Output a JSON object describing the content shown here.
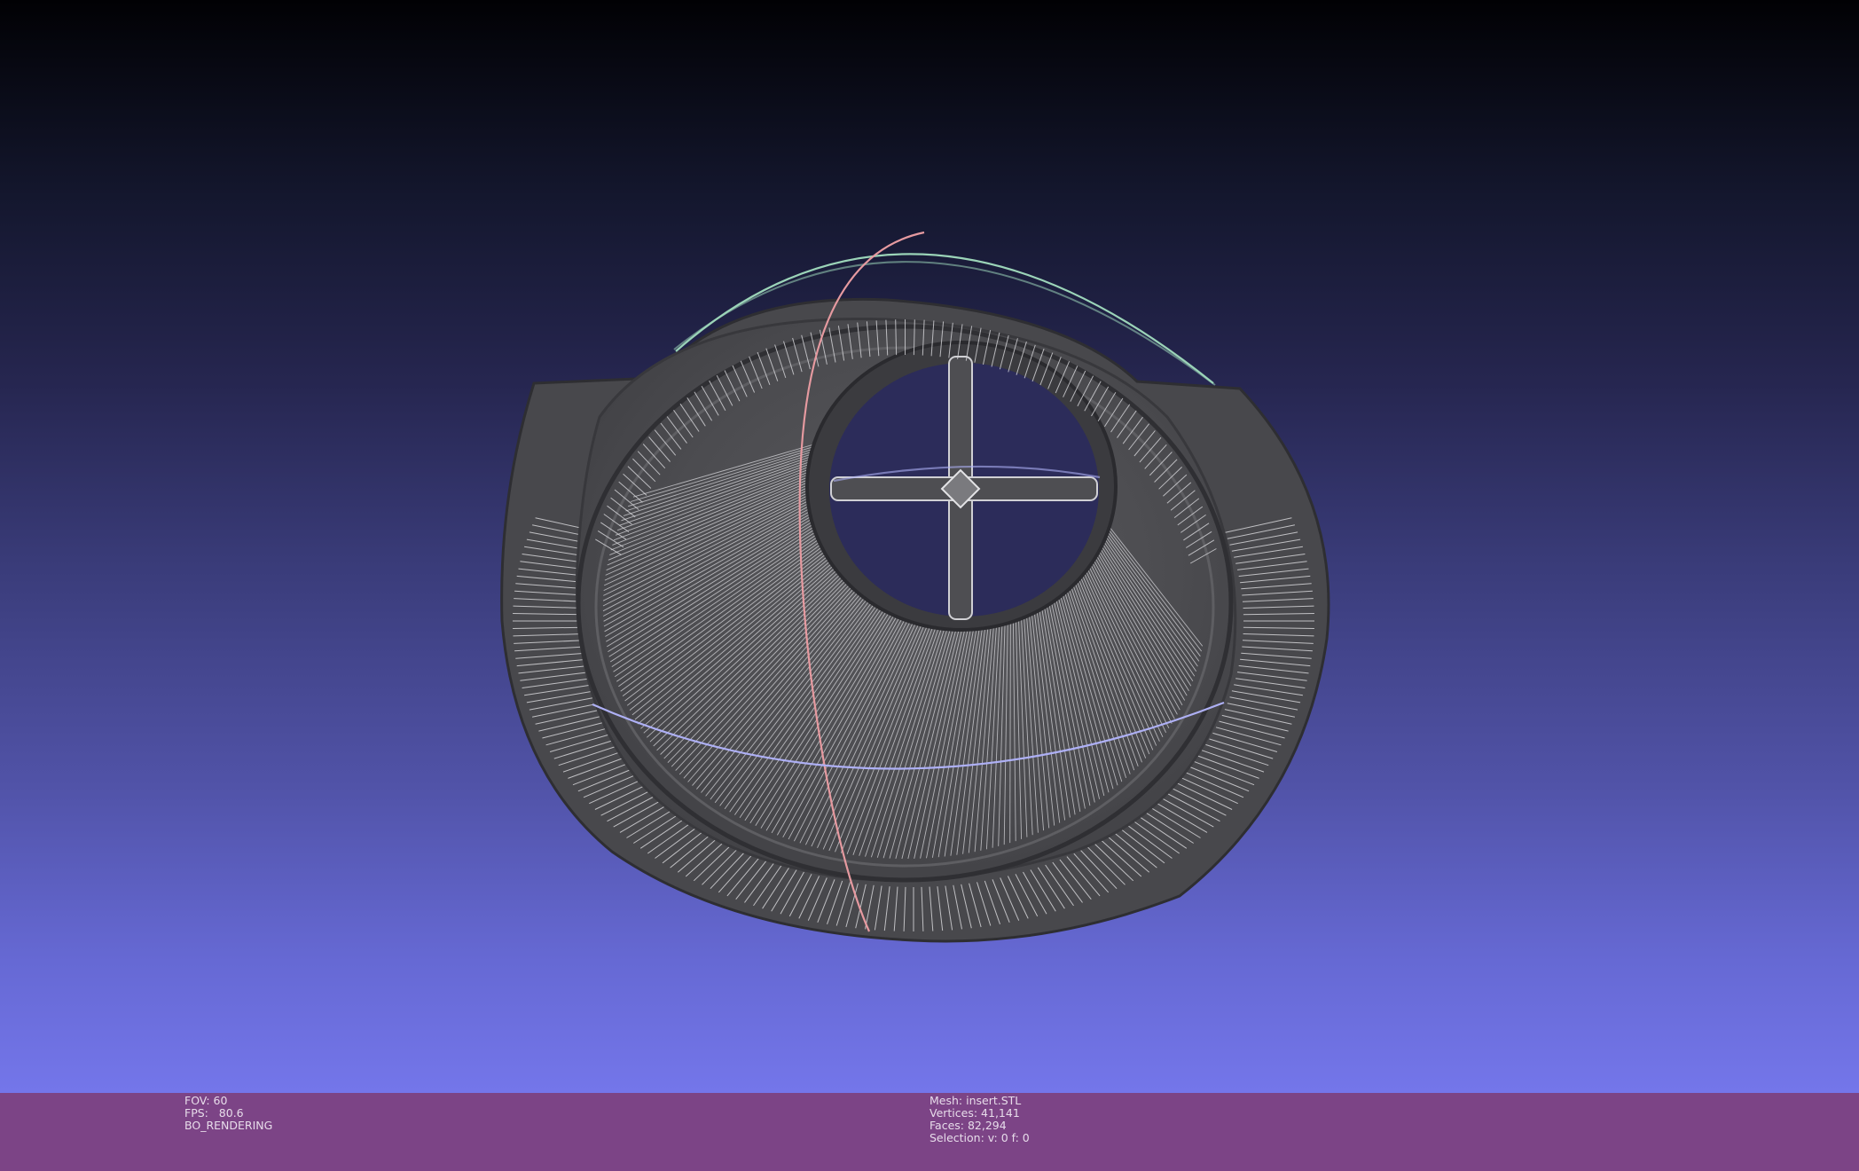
{
  "window": {
    "background_top": "#010104",
    "background_bottom": "#7476ea",
    "info_bar_color": "#7c4486",
    "info_text_color": "#e7dcea"
  },
  "viewer": {
    "fov_text": "FOV: 60",
    "fps_text": "FPS:   80.6",
    "render_mode": "BO_RENDERING"
  },
  "mesh_info": {
    "mesh_text": "Mesh: insert.STL",
    "vertices_text": "Vertices: 41,141",
    "faces_text": "Faces: 82,294",
    "selection_text": "Selection: v: 0 f: 0"
  },
  "trackball": {
    "x_ring_color": "#e69aa0",
    "y_ring_color": "#9bd4b8",
    "z_ring_color": "#aeb0f5"
  },
  "mesh_style": {
    "body_color": "#4a4a4d",
    "wire_color": "#d9d9dc"
  }
}
